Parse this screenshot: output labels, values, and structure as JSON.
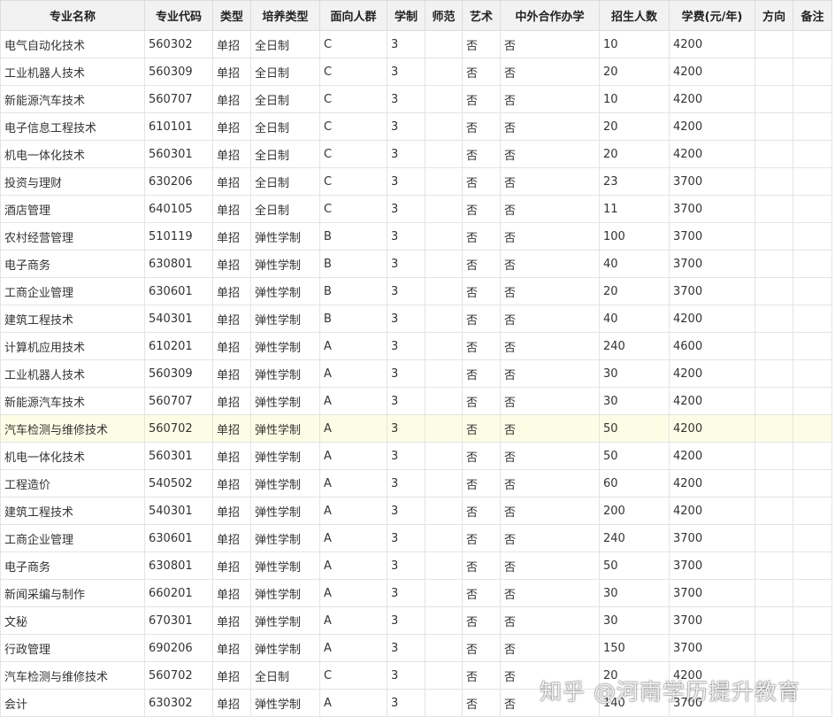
{
  "headers": [
    "专业名称",
    "专业代码",
    "类型",
    "培养类型",
    "面向人群",
    "学制",
    "师范",
    "艺术",
    "中外合作办学",
    "招生人数",
    "学费(元/年)",
    "方向",
    "备注"
  ],
  "rows": [
    [
      "电气自动化技术",
      "560302",
      "单招",
      "全日制",
      "C",
      "3",
      "",
      "否",
      "否",
      "10",
      "4200",
      "",
      ""
    ],
    [
      "工业机器人技术",
      "560309",
      "单招",
      "全日制",
      "C",
      "3",
      "",
      "否",
      "否",
      "20",
      "4200",
      "",
      ""
    ],
    [
      "新能源汽车技术",
      "560707",
      "单招",
      "全日制",
      "C",
      "3",
      "",
      "否",
      "否",
      "10",
      "4200",
      "",
      ""
    ],
    [
      "电子信息工程技术",
      "610101",
      "单招",
      "全日制",
      "C",
      "3",
      "",
      "否",
      "否",
      "20",
      "4200",
      "",
      ""
    ],
    [
      "机电一体化技术",
      "560301",
      "单招",
      "全日制",
      "C",
      "3",
      "",
      "否",
      "否",
      "20",
      "4200",
      "",
      ""
    ],
    [
      "投资与理财",
      "630206",
      "单招",
      "全日制",
      "C",
      "3",
      "",
      "否",
      "否",
      "23",
      "3700",
      "",
      ""
    ],
    [
      "酒店管理",
      "640105",
      "单招",
      "全日制",
      "C",
      "3",
      "",
      "否",
      "否",
      "11",
      "3700",
      "",
      ""
    ],
    [
      "农村经营管理",
      "510119",
      "单招",
      "弹性学制",
      "B",
      "3",
      "",
      "否",
      "否",
      "100",
      "3700",
      "",
      ""
    ],
    [
      "电子商务",
      "630801",
      "单招",
      "弹性学制",
      "B",
      "3",
      "",
      "否",
      "否",
      "40",
      "3700",
      "",
      ""
    ],
    [
      "工商企业管理",
      "630601",
      "单招",
      "弹性学制",
      "B",
      "3",
      "",
      "否",
      "否",
      "20",
      "3700",
      "",
      ""
    ],
    [
      "建筑工程技术",
      "540301",
      "单招",
      "弹性学制",
      "B",
      "3",
      "",
      "否",
      "否",
      "40",
      "4200",
      "",
      ""
    ],
    [
      "计算机应用技术",
      "610201",
      "单招",
      "弹性学制",
      "A",
      "3",
      "",
      "否",
      "否",
      "240",
      "4600",
      "",
      ""
    ],
    [
      "工业机器人技术",
      "560309",
      "单招",
      "弹性学制",
      "A",
      "3",
      "",
      "否",
      "否",
      "30",
      "4200",
      "",
      ""
    ],
    [
      "新能源汽车技术",
      "560707",
      "单招",
      "弹性学制",
      "A",
      "3",
      "",
      "否",
      "否",
      "30",
      "4200",
      "",
      ""
    ],
    [
      "汽车检测与维修技术",
      "560702",
      "单招",
      "弹性学制",
      "A",
      "3",
      "",
      "否",
      "否",
      "50",
      "4200",
      "",
      ""
    ],
    [
      "机电一体化技术",
      "560301",
      "单招",
      "弹性学制",
      "A",
      "3",
      "",
      "否",
      "否",
      "50",
      "4200",
      "",
      ""
    ],
    [
      "工程造价",
      "540502",
      "单招",
      "弹性学制",
      "A",
      "3",
      "",
      "否",
      "否",
      "60",
      "4200",
      "",
      ""
    ],
    [
      "建筑工程技术",
      "540301",
      "单招",
      "弹性学制",
      "A",
      "3",
      "",
      "否",
      "否",
      "200",
      "4200",
      "",
      ""
    ],
    [
      "工商企业管理",
      "630601",
      "单招",
      "弹性学制",
      "A",
      "3",
      "",
      "否",
      "否",
      "240",
      "3700",
      "",
      ""
    ],
    [
      "电子商务",
      "630801",
      "单招",
      "弹性学制",
      "A",
      "3",
      "",
      "否",
      "否",
      "50",
      "3700",
      "",
      ""
    ],
    [
      "新闻采编与制作",
      "660201",
      "单招",
      "弹性学制",
      "A",
      "3",
      "",
      "否",
      "否",
      "30",
      "3700",
      "",
      ""
    ],
    [
      "文秘",
      "670301",
      "单招",
      "弹性学制",
      "A",
      "3",
      "",
      "否",
      "否",
      "30",
      "3700",
      "",
      ""
    ],
    [
      "行政管理",
      "690206",
      "单招",
      "弹性学制",
      "A",
      "3",
      "",
      "否",
      "否",
      "150",
      "3700",
      "",
      ""
    ],
    [
      "汽车检测与维修技术",
      "560702",
      "单招",
      "全日制",
      "C",
      "3",
      "",
      "否",
      "否",
      "20",
      "4200",
      "",
      ""
    ],
    [
      "会计",
      "630302",
      "单招",
      "弹性学制",
      "A",
      "3",
      "",
      "否",
      "否",
      "140",
      "3700",
      "",
      ""
    ]
  ],
  "highlight_row": 14,
  "watermark": "知乎 @河南学历提升教育",
  "colors": {
    "header_bg": "#f2f2f2",
    "highlight_bg": "#fdfde6",
    "border": "#e4e4e4"
  }
}
